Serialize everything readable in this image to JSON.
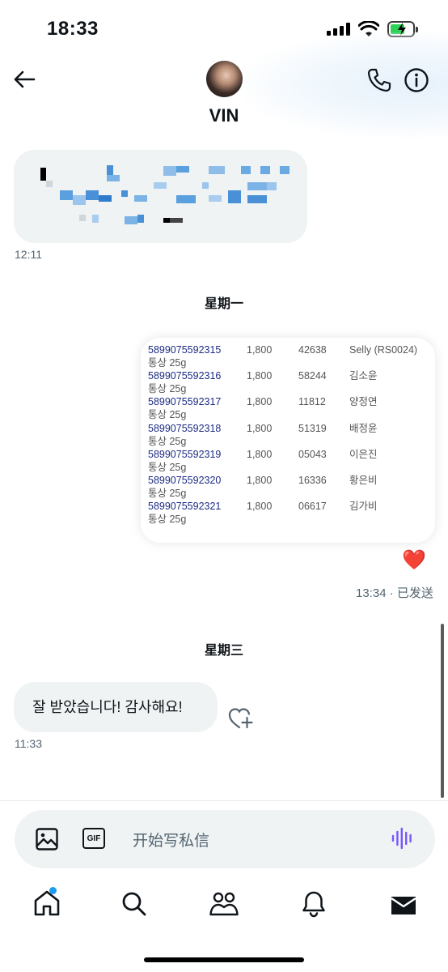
{
  "status_bar": {
    "time": "18:33"
  },
  "header": {
    "contact_name": "VIN"
  },
  "messages": {
    "first_time": "12:11",
    "day_sep_1": "星期一",
    "card_rows": [
      {
        "code": "5899075592315",
        "num": "1,800",
        "zip": "42638",
        "name": "Selly (RS0024)",
        "item": "통상 25g"
      },
      {
        "code": "5899075592316",
        "num": "1,800",
        "zip": "58244",
        "name": "김소윤",
        "item": "통상 25g"
      },
      {
        "code": "5899075592317",
        "num": "1,800",
        "zip": "11812",
        "name": "양정연",
        "item": "통상 25g"
      },
      {
        "code": "5899075592318",
        "num": "1,800",
        "zip": "51319",
        "name": "배정윤",
        "item": "통상 25g"
      },
      {
        "code": "5899075592319",
        "num": "1,800",
        "zip": "05043",
        "name": "이은진",
        "item": "통상 25g"
      },
      {
        "code": "5899075592320",
        "num": "1,800",
        "zip": "16336",
        "name": "황은비",
        "item": "통상 25g"
      },
      {
        "code": "5899075592321",
        "num": "1,800",
        "zip": "06617",
        "name": "김가비",
        "item": "통상 25g"
      }
    ],
    "reaction": "❤️",
    "sent_time": "13:34 · 已发送",
    "day_sep_2": "星期三",
    "reply_text": "잘 받았습니다! 감사해요!",
    "reply_time": "11:33"
  },
  "composer": {
    "placeholder": "开始写私信",
    "gif_label": "GIF"
  },
  "colors": {
    "accent": "#1d9bf0",
    "voice": "#7856ff",
    "heart": "#f91880"
  }
}
